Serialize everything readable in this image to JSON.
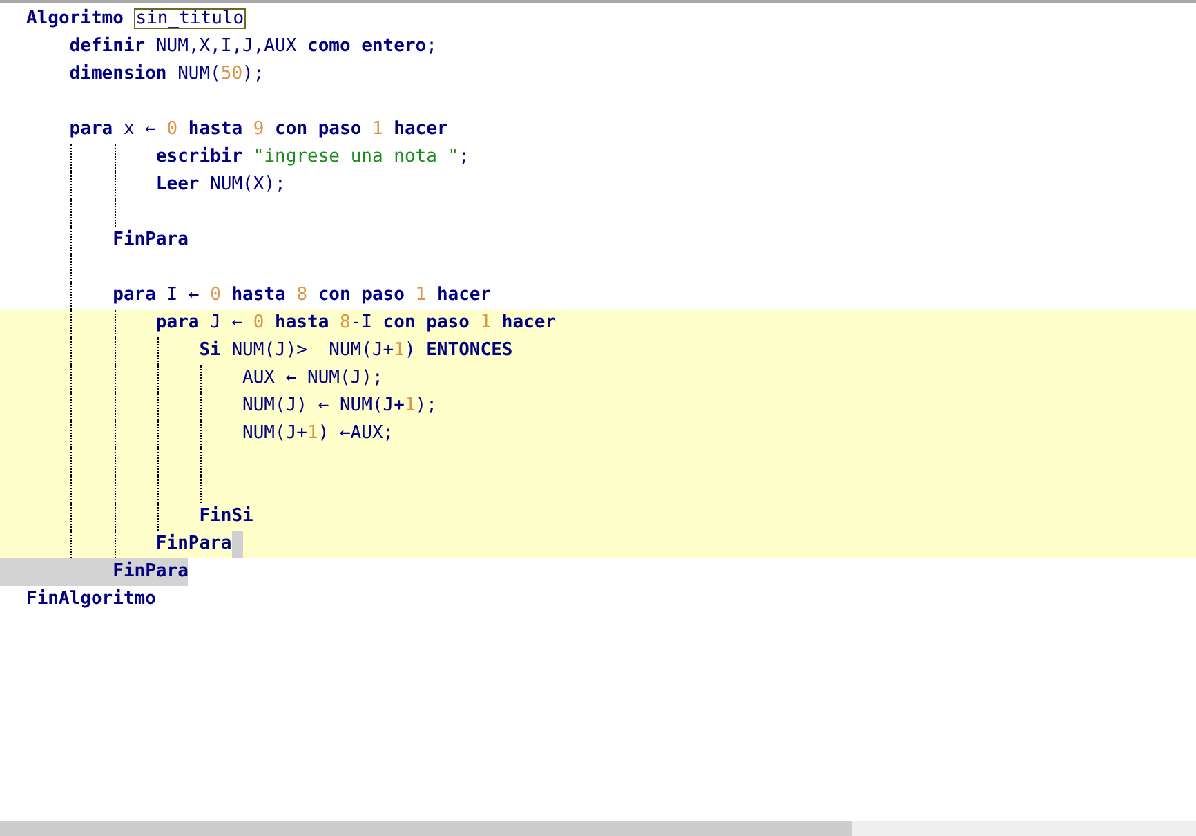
{
  "editor": {
    "lines": [
      {
        "highlighted": false,
        "tokens": [
          {
            "kind": "kw",
            "text": "Algoritmo "
          },
          {
            "kind": "boxed",
            "text": "sin_titulo"
          }
        ]
      },
      {
        "highlighted": false,
        "tokens": [
          {
            "kind": "kw",
            "text": "    definir"
          },
          {
            "kind": "id",
            "text": " NUM,X,I,J,AUX "
          },
          {
            "kind": "kw",
            "text": "como entero"
          },
          {
            "kind": "id",
            "text": ";"
          }
        ]
      },
      {
        "highlighted": false,
        "tokens": [
          {
            "kind": "kw",
            "text": "    dimension"
          },
          {
            "kind": "id",
            "text": " NUM("
          },
          {
            "kind": "num",
            "text": "50"
          },
          {
            "kind": "id",
            "text": ");"
          }
        ]
      },
      {
        "highlighted": false
      },
      {
        "highlighted": false,
        "tokens": [
          {
            "kind": "kw",
            "text": "    para"
          },
          {
            "kind": "id",
            "text": " x ← "
          },
          {
            "kind": "num",
            "text": "0"
          },
          {
            "kind": "kw",
            "text": " hasta "
          },
          {
            "kind": "num",
            "text": "9"
          },
          {
            "kind": "kw",
            "text": " con paso "
          },
          {
            "kind": "num",
            "text": "1"
          },
          {
            "kind": "kw",
            "text": " hacer"
          }
        ]
      },
      {
        "highlighted": false,
        "tokens": [
          {
            "kind": "kw",
            "text": "            escribir "
          },
          {
            "kind": "str",
            "text": "\"ingrese una nota \""
          },
          {
            "kind": "id",
            "text": ";"
          }
        ]
      },
      {
        "highlighted": false,
        "tokens": [
          {
            "kind": "kw",
            "text": "            Leer"
          },
          {
            "kind": "id",
            "text": " NUM(X);"
          }
        ]
      },
      {
        "highlighted": false
      },
      {
        "highlighted": false,
        "tokens": [
          {
            "kind": "kw",
            "text": "        FinPara"
          }
        ]
      },
      {
        "highlighted": false
      },
      {
        "highlighted": false,
        "tokens": [
          {
            "kind": "kw",
            "text": "        para"
          },
          {
            "kind": "id",
            "text": " I ← "
          },
          {
            "kind": "num",
            "text": "0"
          },
          {
            "kind": "kw",
            "text": " hasta "
          },
          {
            "kind": "num",
            "text": "8"
          },
          {
            "kind": "kw",
            "text": " con paso "
          },
          {
            "kind": "num",
            "text": "1"
          },
          {
            "kind": "kw",
            "text": " hacer"
          }
        ]
      },
      {
        "highlighted": true,
        "tokens": [
          {
            "kind": "kw",
            "text": "            para"
          },
          {
            "kind": "id",
            "text": " J ← "
          },
          {
            "kind": "num",
            "text": "0"
          },
          {
            "kind": "kw",
            "text": " hasta "
          },
          {
            "kind": "num",
            "text": "8"
          },
          {
            "kind": "id",
            "text": "-I"
          },
          {
            "kind": "kw",
            "text": " con paso "
          },
          {
            "kind": "num",
            "text": "1"
          },
          {
            "kind": "kw",
            "text": " hacer"
          }
        ]
      },
      {
        "highlighted": true,
        "tokens": [
          {
            "kind": "kw",
            "text": "                Si"
          },
          {
            "kind": "id",
            "text": " NUM(J)>  NUM(J+"
          },
          {
            "kind": "num",
            "text": "1"
          },
          {
            "kind": "id",
            "text": ") "
          },
          {
            "kind": "kw",
            "text": "ENTONCES"
          }
        ]
      },
      {
        "highlighted": true,
        "tokens": [
          {
            "kind": "id",
            "text": "                    AUX ← NUM(J);"
          }
        ]
      },
      {
        "highlighted": true,
        "tokens": [
          {
            "kind": "id",
            "text": "                    NUM(J) ← NUM(J+"
          },
          {
            "kind": "num",
            "text": "1"
          },
          {
            "kind": "id",
            "text": ");"
          }
        ]
      },
      {
        "highlighted": true,
        "tokens": [
          {
            "kind": "id",
            "text": "                    NUM(J+"
          },
          {
            "kind": "num",
            "text": "1"
          },
          {
            "kind": "id",
            "text": ") ←AUX;"
          }
        ]
      },
      {
        "highlighted": true
      },
      {
        "highlighted": true
      },
      {
        "highlighted": true,
        "tokens": [
          {
            "kind": "kw",
            "text": "                FinSi"
          }
        ]
      },
      {
        "highlighted": true,
        "cursor": true,
        "tokens": [
          {
            "kind": "kw",
            "text": "            FinPara"
          }
        ]
      },
      {
        "highlighted": false,
        "selected": true,
        "tokens": [
          {
            "kind": "kw",
            "text": "        FinPara"
          }
        ]
      },
      {
        "highlighted": false,
        "tokens": [
          {
            "kind": "kw",
            "text": "FinAlgoritmo"
          }
        ]
      }
    ]
  }
}
